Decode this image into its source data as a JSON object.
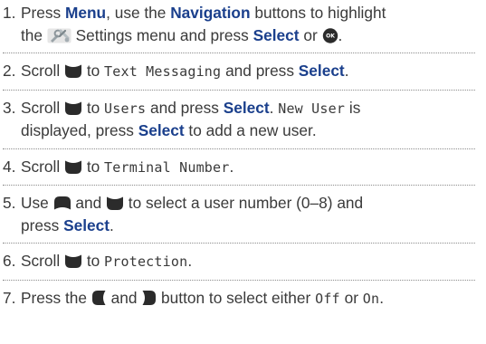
{
  "steps": [
    {
      "num": "1.",
      "t1": "Press ",
      "menu": "Menu",
      "t2": ", use the ",
      "navigation": "Navigation",
      "t3": " buttons to highlight",
      "t4": "the ",
      "t5": " Settings menu and press ",
      "select": "Select",
      "t6": " or ",
      "t7": "."
    },
    {
      "num": "2.",
      "t1": "Scroll ",
      "t2": " to ",
      "mono": "Text Messaging",
      "t3": " and press ",
      "select": "Select",
      "t4": "."
    },
    {
      "num": "3.",
      "t1": "Scroll ",
      "t2": " to ",
      "mono1": "Users",
      "t3": " and press ",
      "select1": "Select",
      "t4": ". ",
      "mono2": "New User",
      "t5": " is",
      "t6": "displayed, press ",
      "select2": "Select",
      "t7": " to add a new user."
    },
    {
      "num": "4.",
      "t1": "Scroll ",
      "t2": " to ",
      "mono": "Terminal Number",
      "t3": "."
    },
    {
      "num": "5.",
      "t1": "Use ",
      "t2": " and ",
      "t3": " to select a user number (0–8) and",
      "t4": "press ",
      "select": "Select",
      "t5": "."
    },
    {
      "num": "6.",
      "t1": "Scroll ",
      "t2": " to ",
      "mono": "Protection",
      "t3": "."
    },
    {
      "num": "7.",
      "t1": "Press the ",
      "t2": " and ",
      "t3": " button to select either ",
      "mono1": "Off",
      "t4": " or ",
      "mono2": "On",
      "t5": "."
    }
  ],
  "colors": {
    "text": "#3a3a3a",
    "keyword": "#1a3f8c",
    "button_icon": "#2b2b2b",
    "rule": "#8c8c8c"
  },
  "icons": {
    "settings": "settings-menu-icon",
    "ok": "ok-button-icon",
    "down": "nav-down-icon",
    "up": "nav-up-icon",
    "left": "nav-left-icon",
    "right": "nav-right-icon"
  }
}
